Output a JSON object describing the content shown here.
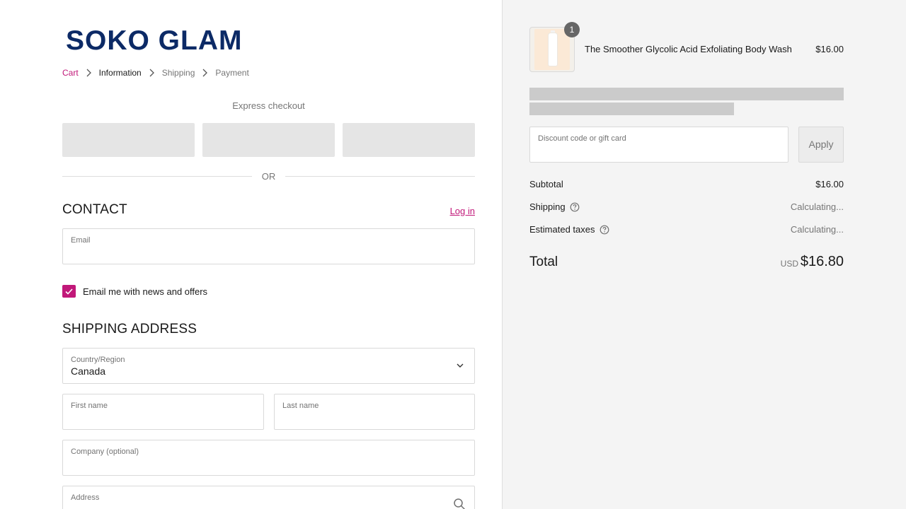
{
  "brand": {
    "logo_text": "SOKO GLAM"
  },
  "breadcrumb": {
    "items": [
      {
        "label": "Cart"
      },
      {
        "label": "Information"
      },
      {
        "label": "Shipping"
      },
      {
        "label": "Payment"
      }
    ]
  },
  "express": {
    "title": "Express checkout"
  },
  "divider": {
    "or_label": "OR"
  },
  "contact": {
    "title": "CONTACT",
    "login_label": "Log in",
    "email_label": "Email",
    "email_value": "",
    "newsletter_label": "Email me with news and offers",
    "newsletter_checked": true
  },
  "shipping_address": {
    "title": "SHIPPING ADDRESS",
    "country_label": "Country/Region",
    "country_value": "Canada",
    "first_name_label": "First name",
    "last_name_label": "Last name",
    "company_label": "Company (optional)",
    "address_label": "Address"
  },
  "order": {
    "item": {
      "name": "The Smoother Glycolic Acid Exfoliating Body Wash",
      "price": "$16.00",
      "quantity": "1"
    },
    "discount_label": "Discount code or gift card",
    "apply_label": "Apply",
    "subtotal_label": "Subtotal",
    "subtotal_value": "$16.00",
    "shipping_label": "Shipping",
    "shipping_value": "Calculating...",
    "taxes_label": "Estimated taxes",
    "taxes_value": "Calculating...",
    "total_label": "Total",
    "currency": "USD",
    "total_value": "$16.80"
  },
  "colors": {
    "accent": "#c11879",
    "brand": "#0c2a66",
    "sidebar_bg": "#f4f4f4"
  }
}
